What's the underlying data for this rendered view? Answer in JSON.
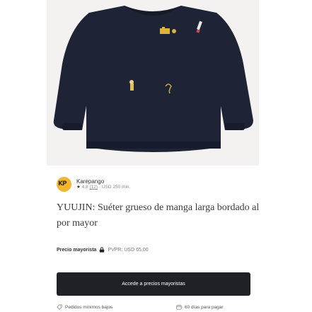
{
  "brand": {
    "name": "Karepango",
    "rating": "4,8",
    "reviews": "(12)",
    "minimum": "USD 250 min."
  },
  "product": {
    "title": "YUUJIN: Suéter grueso de manga larga bordado al por mayor"
  },
  "wholesale": {
    "label": "Precio mayorista",
    "pvpr": "PVPR: USD 65,00"
  },
  "cta": {
    "label": "Accede a precios mayoristas"
  },
  "info": {
    "low_minimums": "Pedidos mínimos bajos",
    "payment_terms": "60 días para pagar"
  },
  "colors": {
    "sweater": "#1e2336",
    "button": "#1f2125",
    "logo": "#f0b62f"
  }
}
